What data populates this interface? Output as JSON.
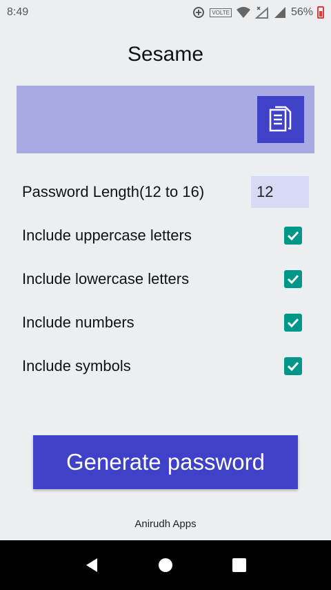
{
  "status": {
    "time": "8:49",
    "volte": "VOLTE",
    "battery": "56%"
  },
  "app": {
    "title": "Sesame"
  },
  "settings": {
    "length_label": "Password Length(12 to 16)",
    "length_value": "12",
    "options": [
      {
        "label": "Include uppercase letters",
        "checked": true
      },
      {
        "label": "Include lowercase letters",
        "checked": true
      },
      {
        "label": "Include numbers",
        "checked": true
      },
      {
        "label": "Include symbols",
        "checked": true
      }
    ]
  },
  "actions": {
    "generate_label": "Generate password"
  },
  "footer": {
    "text": "Anirudh Apps"
  },
  "colors": {
    "primary": "#3f41c8",
    "output_bg": "#a8aae3",
    "checkbox": "#009688"
  }
}
